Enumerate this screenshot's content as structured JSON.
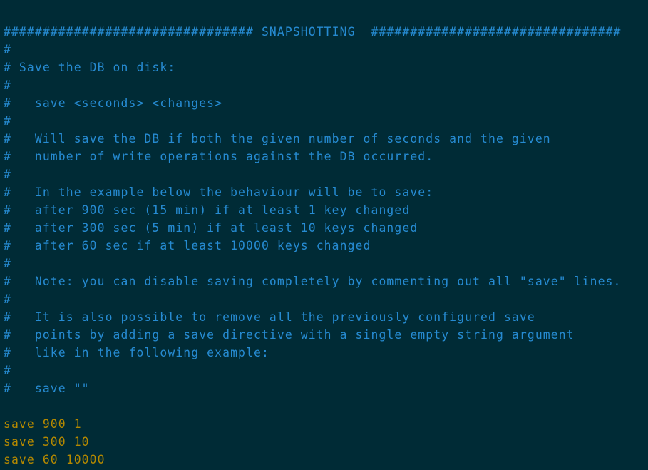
{
  "theme": {
    "background": "#002b36",
    "comment_color": "#268bd2",
    "directive_color": "#b58900"
  },
  "editor": {
    "lines": [
      {
        "kind": "comment",
        "text": "################################ SNAPSHOTTING  ################################"
      },
      {
        "kind": "comment",
        "text": "#"
      },
      {
        "kind": "comment",
        "text": "# Save the DB on disk:"
      },
      {
        "kind": "comment",
        "text": "#"
      },
      {
        "kind": "comment",
        "text": "#   save <seconds> <changes>"
      },
      {
        "kind": "comment",
        "text": "#"
      },
      {
        "kind": "comment",
        "text": "#   Will save the DB if both the given number of seconds and the given"
      },
      {
        "kind": "comment",
        "text": "#   number of write operations against the DB occurred."
      },
      {
        "kind": "comment",
        "text": "#"
      },
      {
        "kind": "comment",
        "text": "#   In the example below the behaviour will be to save:"
      },
      {
        "kind": "comment",
        "text": "#   after 900 sec (15 min) if at least 1 key changed"
      },
      {
        "kind": "comment",
        "text": "#   after 300 sec (5 min) if at least 10 keys changed"
      },
      {
        "kind": "comment",
        "text": "#   after 60 sec if at least 10000 keys changed"
      },
      {
        "kind": "comment",
        "text": "#"
      },
      {
        "kind": "comment",
        "text": "#   Note: you can disable saving completely by commenting out all \"save\" lines."
      },
      {
        "kind": "comment",
        "text": "#"
      },
      {
        "kind": "comment",
        "text": "#   It is also possible to remove all the previously configured save"
      },
      {
        "kind": "comment",
        "text": "#   points by adding a save directive with a single empty string argument"
      },
      {
        "kind": "comment",
        "text": "#   like in the following example:"
      },
      {
        "kind": "comment",
        "text": "#"
      },
      {
        "kind": "comment",
        "text": "#   save \"\""
      },
      {
        "kind": "blank",
        "text": ""
      },
      {
        "kind": "directive",
        "text": "save 900 1"
      },
      {
        "kind": "directive",
        "text": "save 300 10"
      },
      {
        "kind": "directive",
        "text": "save 60 10000"
      }
    ]
  }
}
